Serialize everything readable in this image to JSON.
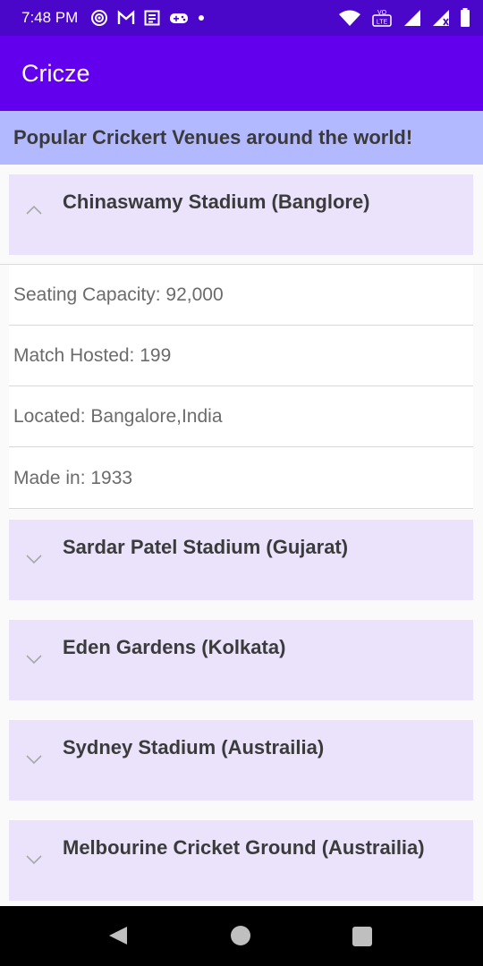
{
  "status_bar": {
    "time": "7:48 PM",
    "icons": [
      "target-icon",
      "gmail-icon",
      "news-icon",
      "game-icon",
      "dot-icon"
    ],
    "right_icons": [
      "wifi-icon",
      "volte-icon",
      "signal-icon",
      "signal-2-icon",
      "battery-icon"
    ]
  },
  "app_bar": {
    "title": "Cricze"
  },
  "subheader": {
    "text": "Popular Crickert Venues around the world!"
  },
  "groups": [
    {
      "title": "Chinaswamy Stadium (Banglore)",
      "expanded": true,
      "children": [
        "Seating Capacity: 92,000",
        "Match Hosted: 199",
        "Located: Bangalore,India",
        "Made in: 1933"
      ]
    },
    {
      "title": "Sardar Patel Stadium (Gujarat)",
      "expanded": false
    },
    {
      "title": "Eden Gardens (Kolkata)",
      "expanded": false
    },
    {
      "title": "Sydney Stadium (Austrailia)",
      "expanded": false
    },
    {
      "title": "Melbourine Cricket Ground (Austrailia)",
      "expanded": false
    }
  ],
  "colors": {
    "status_bar": "#4a06c9",
    "app_bar": "#6200ee",
    "subheader": "#b3b9ff",
    "group_bg": "#ebe3fc"
  }
}
